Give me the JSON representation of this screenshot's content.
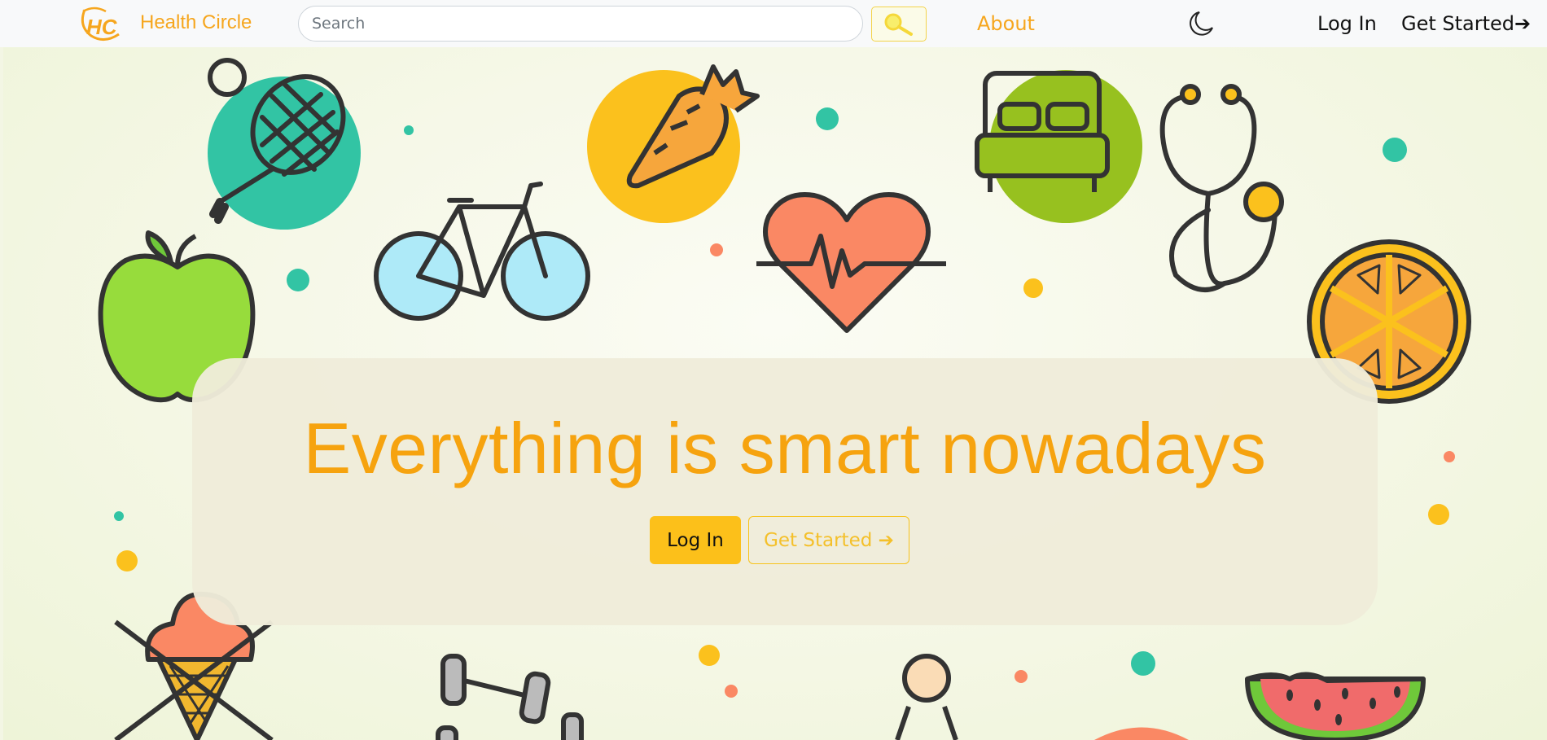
{
  "navbar": {
    "logo_text": "HC",
    "brand": "Health Circle",
    "search": {
      "placeholder": "Search",
      "value": ""
    },
    "search_icon": "magnifier-icon",
    "about": "About",
    "theme_icon": "moon-icon",
    "login": "Log In",
    "get_started": "Get Started➔"
  },
  "hero": {
    "headline": "Everything is smart nowadays",
    "login_button": "Log In",
    "get_started_button": "Get Started ➔"
  },
  "colors": {
    "accent": "#f6a61e",
    "button_yellow": "#fcc01a",
    "teal": "#32c4a4",
    "green": "#97c11f",
    "coral": "#fa8864",
    "sky": "#aeeaf8"
  },
  "illustrations": [
    "tennis-racket-icon",
    "bicycle-icon",
    "carrot-icon",
    "heartbeat-icon",
    "bed-icon",
    "stethoscope-icon",
    "apple-icon",
    "orange-slice-icon",
    "ice-cream-icon",
    "dumbbell-icon",
    "person-icon",
    "watermelon-icon"
  ]
}
